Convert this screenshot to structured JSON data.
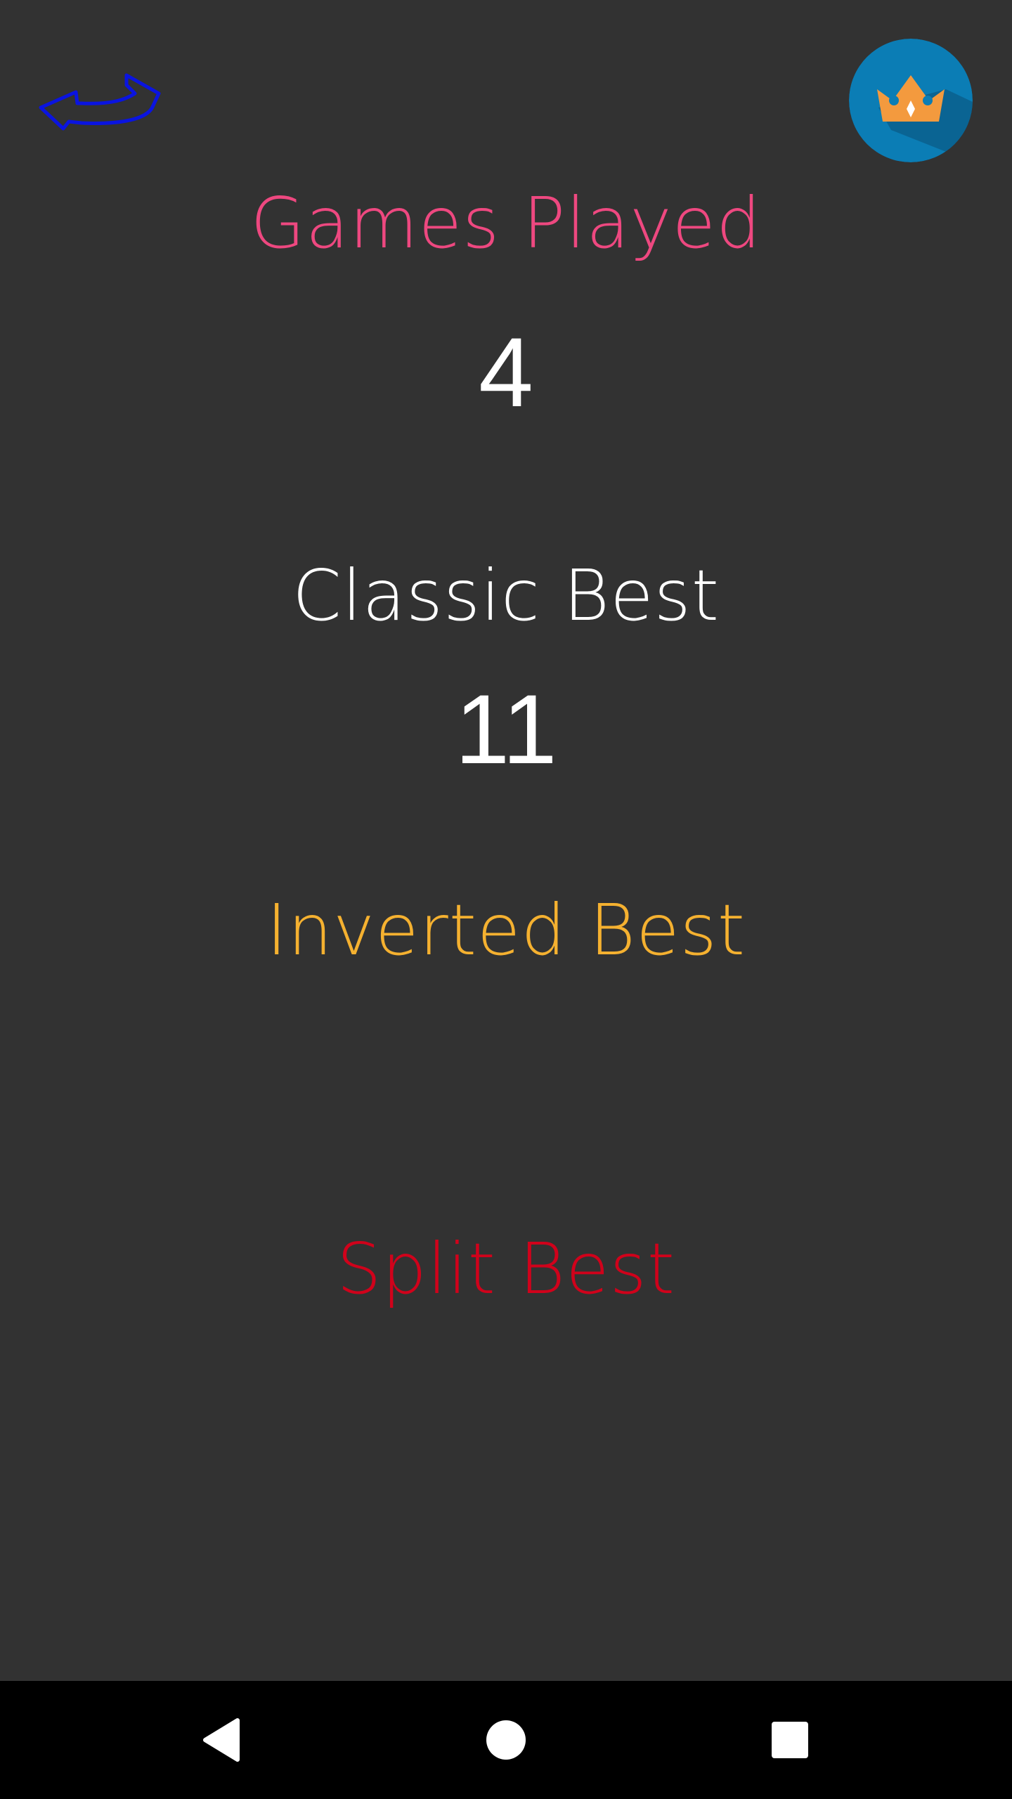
{
  "stats": {
    "games_played": {
      "label": "Games Played",
      "value": "4",
      "color": "#EE4880"
    },
    "classic_best": {
      "label": "Classic Best",
      "value": "11",
      "color": "#FFFFFF"
    },
    "inverted_best": {
      "label": "Inverted Best",
      "value": "",
      "color": "#F5B130"
    },
    "split_best": {
      "label": "Split Best",
      "value": "",
      "color": "#D0021B"
    }
  },
  "icons": {
    "back": "back-arrow-icon",
    "leaderboard": "crown-icon",
    "nav_back": "nav-back-icon",
    "nav_home": "nav-home-icon",
    "nav_recents": "nav-recents-icon"
  },
  "colors": {
    "background": "#323232",
    "back_arrow": "#0A14E0",
    "crown_badge": "#0B7DB5",
    "crown": "#F39A3E",
    "nav_bar": "#000000"
  }
}
